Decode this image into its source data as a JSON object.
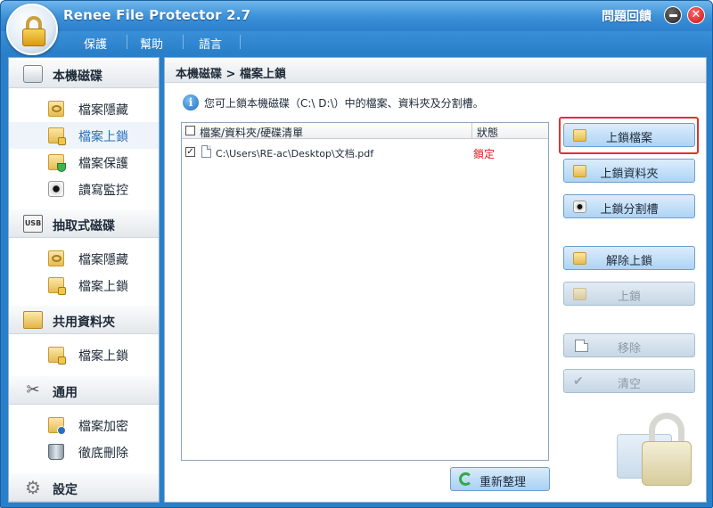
{
  "app": {
    "title": "Renee File Protector 2.7",
    "feedback_label": "問題回饋"
  },
  "menu": [
    "保護",
    "幫助",
    "語言"
  ],
  "sidebar": {
    "sections": [
      {
        "label": "本機磁碟",
        "icon": "hard-drive-icon",
        "items": [
          {
            "label": "檔案隱藏",
            "icon": "file-hide-icon"
          },
          {
            "label": "檔案上鎖",
            "icon": "file-lock-icon",
            "selected": true
          },
          {
            "label": "檔案保護",
            "icon": "file-protect-icon"
          },
          {
            "label": "讀寫監控",
            "icon": "monitor-icon"
          }
        ]
      },
      {
        "label": "抽取式磁碟",
        "icon": "usb-drive-icon",
        "icon_text": "USB",
        "items": [
          {
            "label": "檔案隱藏",
            "icon": "file-hide-icon"
          },
          {
            "label": "檔案上鎖",
            "icon": "file-lock-icon"
          }
        ]
      },
      {
        "label": "共用資料夾",
        "icon": "shared-folder-icon",
        "items": [
          {
            "label": "檔案上鎖",
            "icon": "file-lock-icon"
          }
        ]
      },
      {
        "label": "通用",
        "icon": "tools-icon",
        "items": [
          {
            "label": "檔案加密",
            "icon": "file-encrypt-icon"
          },
          {
            "label": "徹底刪除",
            "icon": "shred-icon"
          }
        ]
      },
      {
        "label": "設定",
        "icon": "settings-icon",
        "items": []
      }
    ]
  },
  "main": {
    "breadcrumb": "本機磁碟 > 檔案上鎖",
    "info": "您可上鎖本機磁碟（C:\\ D:\\）中的檔案、資料夾及分割槽。",
    "table": {
      "headers": [
        "檔案/資料夾/硬碟清單",
        "狀態"
      ],
      "rows": [
        {
          "checked": true,
          "path": "C:\\Users\\RE-ac\\Desktop\\文档.pdf",
          "status": "鎖定"
        }
      ]
    },
    "refresh_label": "重新整理"
  },
  "actions": [
    {
      "label": "上鎖檔案",
      "enabled": true,
      "highlighted": true
    },
    {
      "label": "上鎖資料夾",
      "enabled": true
    },
    {
      "label": "上鎖分割槽",
      "enabled": true
    },
    {
      "label": "解除上鎖",
      "enabled": true
    },
    {
      "label": "上鎖",
      "enabled": false
    },
    {
      "label": "移除",
      "enabled": false
    },
    {
      "label": "清空",
      "enabled": false
    }
  ],
  "colors": {
    "accent": "#2a7fc9",
    "locked_status": "#e01818",
    "highlight": "#e0312b"
  }
}
